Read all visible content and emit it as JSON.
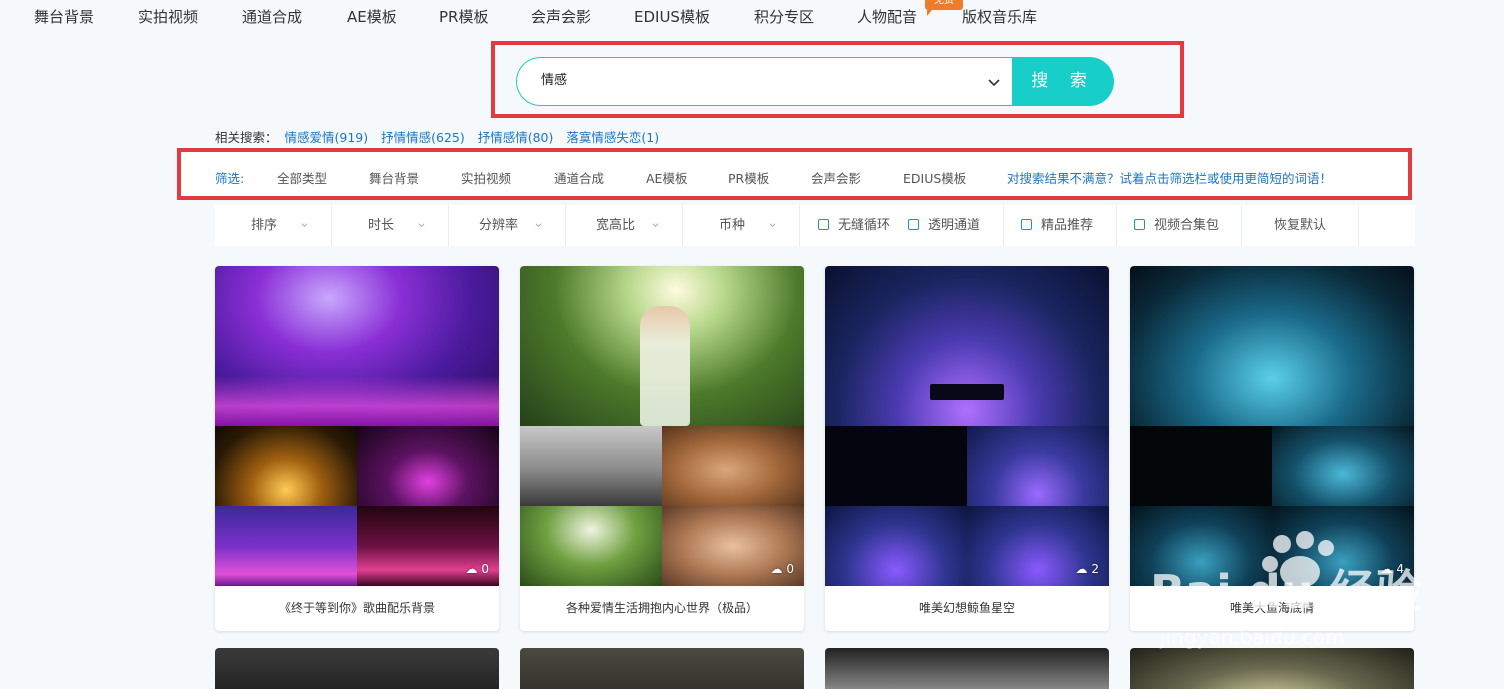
{
  "nav": {
    "items": [
      "舞台背景",
      "实拍视频",
      "通道合成",
      "AE模板",
      "PR模板",
      "会声会影",
      "EDIUS模板",
      "积分专区",
      "人物配音",
      "版权音乐库"
    ],
    "free_badge": "免费"
  },
  "search": {
    "value": "情感",
    "button_label": "搜 索",
    "accent_color": "#17cfc8"
  },
  "related": {
    "label": "相关搜索：",
    "links": [
      "情感爱情(919)",
      "抒情情感(625)",
      "抒情感情(80)",
      "落寞情感失恋(1)"
    ]
  },
  "filter": {
    "label": "筛选:",
    "types": [
      "全部类型",
      "舞台背景",
      "实拍视频",
      "通道合成",
      "AE模板",
      "PR模板",
      "会声会影",
      "EDIUS模板"
    ],
    "hint": "对搜索结果不满意？试着点击筛选栏或使用更简短的词语！"
  },
  "sortbar": {
    "dropdowns": [
      "排序",
      "时长",
      "分辨率",
      "宽高比",
      "币种"
    ],
    "checkboxes": [
      "无缝循环",
      "透明通道",
      "精品推荐",
      "视频合集包"
    ],
    "reset": "恢复默认"
  },
  "cards": [
    {
      "title": "《终于等到你》歌曲配乐背景",
      "downloads": "0"
    },
    {
      "title": "各种爱情生活拥抱内心世界（极品）",
      "downloads": "0"
    },
    {
      "title": "唯美幻想鲸鱼星空",
      "downloads": "2"
    },
    {
      "title": "唯美大鱼海底情",
      "downloads": "4"
    }
  ],
  "watermark": {
    "brand": "Bai du 经验",
    "url": "jingyan.baidu.com"
  },
  "colors": {
    "highlight_frame": "#e23a3e",
    "link": "#1b76c4",
    "badge": "#f07c2b"
  }
}
